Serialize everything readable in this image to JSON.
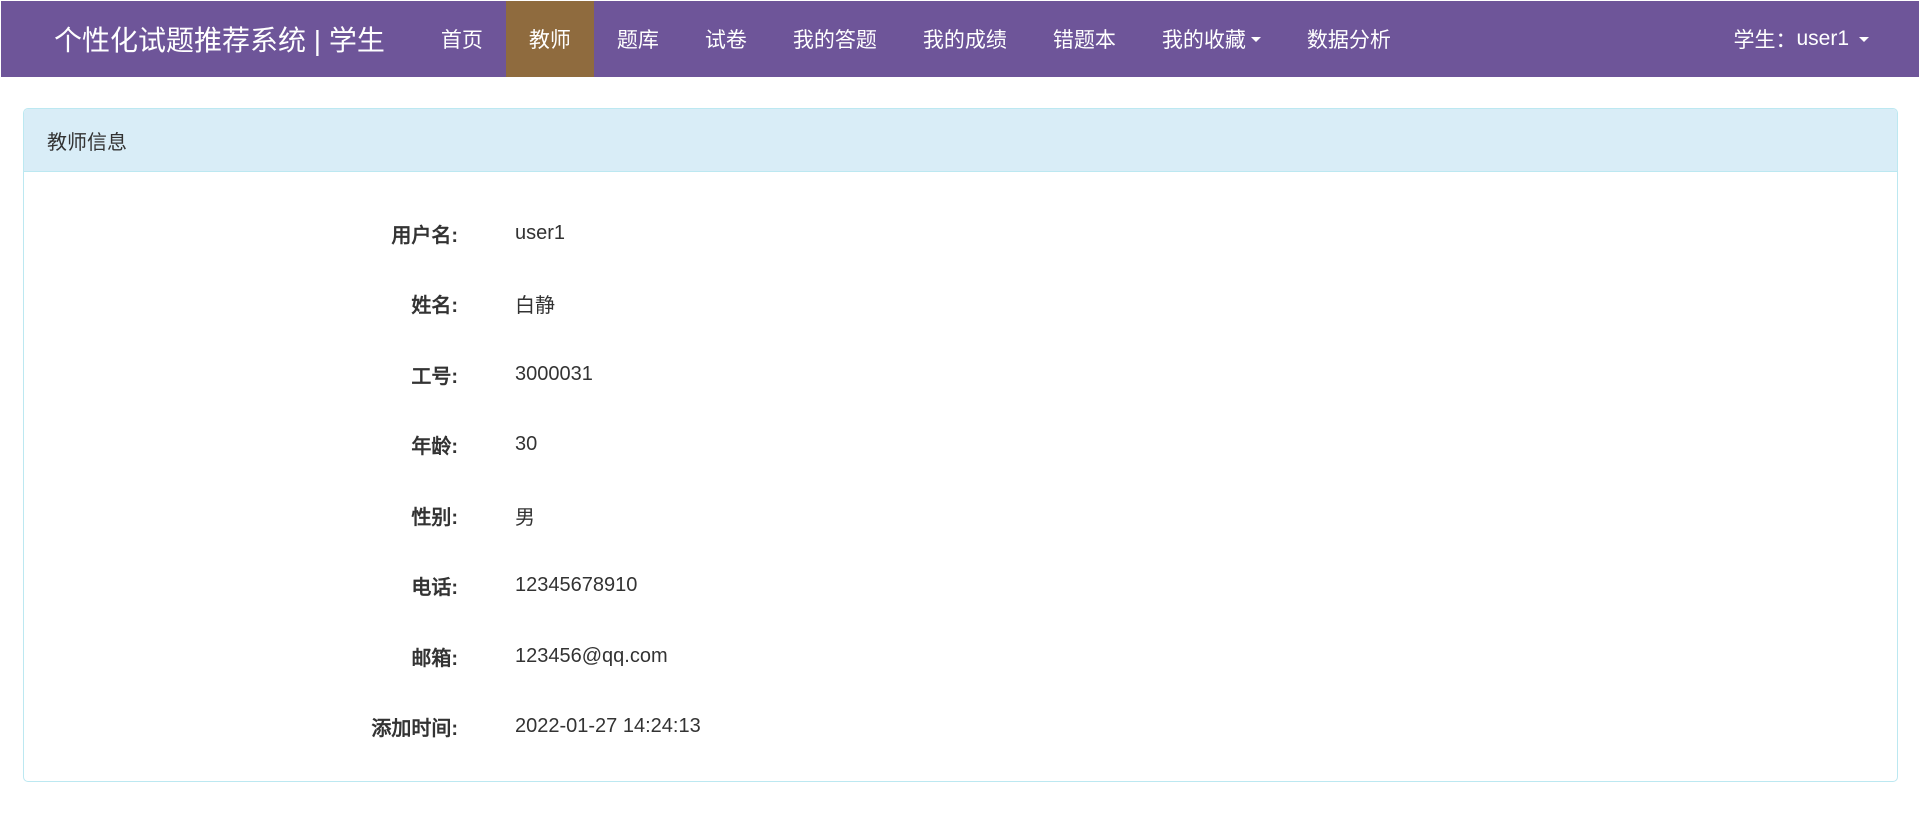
{
  "navbar": {
    "brand": "个性化试题推荐系统 | 学生",
    "items": [
      {
        "label": "首页",
        "active": false
      },
      {
        "label": "教师",
        "active": true
      },
      {
        "label": "题库",
        "active": false
      },
      {
        "label": "试卷",
        "active": false
      },
      {
        "label": "我的答题",
        "active": false
      },
      {
        "label": "我的成绩",
        "active": false
      },
      {
        "label": "错题本",
        "active": false
      },
      {
        "label": "我的收藏",
        "active": false,
        "dropdown": true
      },
      {
        "label": "数据分析",
        "active": false
      }
    ],
    "user_label": "学生：",
    "user_name": "user1"
  },
  "panel": {
    "title": "教师信息",
    "fields": [
      {
        "label": "用户名:",
        "value": "user1"
      },
      {
        "label": "姓名:",
        "value": "白静"
      },
      {
        "label": "工号:",
        "value": "3000031"
      },
      {
        "label": "年龄:",
        "value": "30"
      },
      {
        "label": "性别:",
        "value": "男"
      },
      {
        "label": "电话:",
        "value": "12345678910"
      },
      {
        "label": "邮箱:",
        "value": "123456@qq.com"
      },
      {
        "label": "添加时间:",
        "value": "2022-01-27 14:24:13"
      }
    ]
  },
  "colors": {
    "navbar_bg": "#6e5599",
    "active_tab_bg": "#8f6b3e",
    "panel_heading_bg": "#d9edf7",
    "panel_border": "#bce8f1"
  }
}
